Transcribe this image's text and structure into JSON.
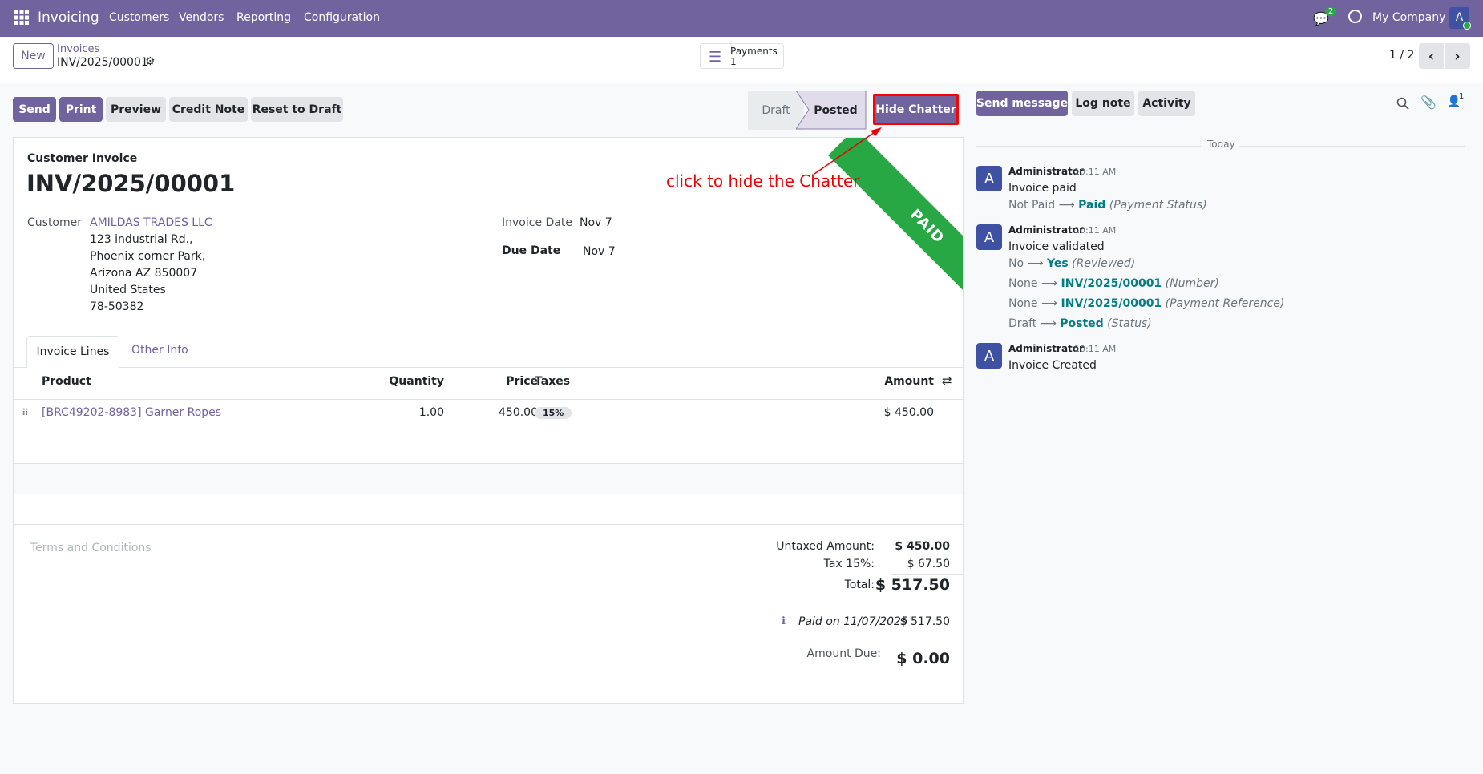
{
  "navbar": {
    "app": "Invoicing",
    "menu": [
      "Customers",
      "Vendors",
      "Reporting",
      "Configuration"
    ],
    "chat_count": "2",
    "company": "My Company",
    "avatar": "A"
  },
  "control": {
    "new": "New",
    "breadcrumb": "Invoices",
    "record": "INV/2025/00001",
    "payments_label": "Payments",
    "payments_count": "1",
    "pager": "1 / 2"
  },
  "actions": [
    "Send",
    "Print",
    "Preview",
    "Credit Note",
    "Reset to Draft"
  ],
  "status": {
    "draft": "Draft",
    "posted": "Posted"
  },
  "hide_chatter": "Hide Chatter",
  "annotation": "click to hide the Chatter",
  "invoice": {
    "type": "Customer Invoice",
    "number": "INV/2025/00001",
    "customer_label": "Customer",
    "customer": "AMILDAS TRADES LLC",
    "address": [
      "123 industrial Rd.,",
      "Phoenix corner Park,",
      "Arizona AZ 850007",
      "United States",
      "78-50382"
    ],
    "invoice_date_label": "Invoice Date",
    "invoice_date": "Nov 7",
    "due_date_label": "Due Date",
    "due_date": "Nov 7",
    "ribbon": "PAID"
  },
  "tabs": [
    "Invoice Lines",
    "Other Info"
  ],
  "table": {
    "headers": {
      "product": "Product",
      "quantity": "Quantity",
      "price": "Price",
      "taxes": "Taxes",
      "amount": "Amount"
    },
    "rows": [
      {
        "product": "[BRC49202-8983] Garner Ropes",
        "quantity": "1.00",
        "price": "450.00",
        "tax": "15%",
        "amount": "$ 450.00"
      }
    ]
  },
  "terms": "Terms and Conditions",
  "totals": {
    "untaxed_label": "Untaxed Amount:",
    "untaxed": "$ 450.00",
    "tax_label": "Tax 15%:",
    "tax": "$ 67.50",
    "total_label": "Total:",
    "total": "$ 517.50",
    "paid_label": "Paid on 11/07/2025",
    "paid": "$ 517.50",
    "due_label": "Amount Due:",
    "due": "$ 0.00"
  },
  "chatter": {
    "send": "Send message",
    "log": "Log note",
    "activity": "Activity",
    "followers": "1",
    "today": "Today",
    "messages": [
      {
        "author": "Administrator",
        "time": "10:11 AM",
        "body": "Invoice paid",
        "changes": [
          {
            "old": "Not Paid",
            "new": "Paid",
            "field": "(Payment Status)"
          }
        ]
      },
      {
        "author": "Administrator",
        "time": "10:11 AM",
        "body": "Invoice validated",
        "changes": [
          {
            "old": "No",
            "new": "Yes",
            "field": "(Reviewed)"
          },
          {
            "old": "None",
            "new": "INV/2025/00001",
            "field": "(Number)"
          },
          {
            "old": "None",
            "new": "INV/2025/00001",
            "field": "(Payment Reference)"
          },
          {
            "old": "Draft",
            "new": "Posted",
            "field": "(Status)"
          }
        ]
      },
      {
        "author": "Administrator",
        "time": "10:11 AM",
        "body": "Invoice Created",
        "changes": []
      }
    ]
  }
}
